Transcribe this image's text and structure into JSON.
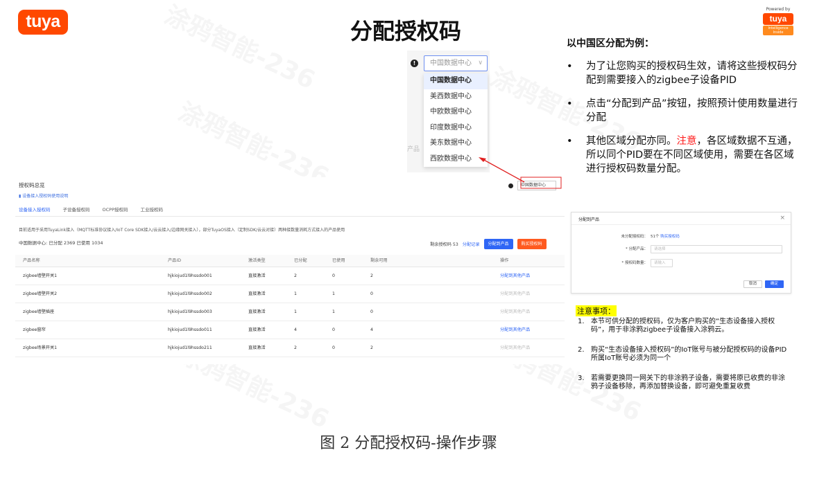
{
  "header": {
    "logo_text": "tuya",
    "title": "分配授权码",
    "powered_by": "Powered by",
    "powered_logo": "tuya",
    "powered_sub": "Intelligence Inside"
  },
  "dropdown": {
    "placeholder": "中国数据中心",
    "options": [
      "中国数据中心",
      "美西数据中心",
      "中欧数据中心",
      "印度数据中心",
      "美东数据中心",
      "西欧数据中心"
    ],
    "side_label": "产品"
  },
  "portal": {
    "title": "授权码总览",
    "help_link": "设备接入授权码使用说明",
    "tabs": [
      "设备接入授权码",
      "子设备授权码",
      "OCPP授权码",
      "工业授权码"
    ],
    "description": "目前适用于采用TuyaLink接入（MQTT标准协议接入/IoT Core SDK接入/云云接入/边缘网关接入），部分TuyaOS接入（定制SDK/云云对接）两种接数量消耗方式接入的产品使用",
    "stats": "中国数据中心: 已分配 2369    已使用 1034",
    "region_select": "中国数据中心",
    "remaining": "剩余授权码 53",
    "records_link": "分配记录",
    "assign_button": "分配到产品",
    "buy_button": "购买授权码",
    "columns": [
      "产品名称",
      "产品ID",
      "激活类型",
      "已分配",
      "已使用",
      "剩余可用",
      "操作"
    ],
    "rows": [
      {
        "name": "zigbee墙壁开关1",
        "pid": "hjkiojud1l9hssdo001",
        "type": "直接激活",
        "assigned": "2",
        "used": "0",
        "remain": "2",
        "action": "分配到其他产品"
      },
      {
        "name": "zigbee墙壁开关2",
        "pid": "hjkiojud1l9hssdo002",
        "type": "直接激活",
        "assigned": "1",
        "used": "1",
        "remain": "0",
        "action": "分配到其他产品"
      },
      {
        "name": "zigbee墙壁插座",
        "pid": "hjkiojud1l9hssdo003",
        "type": "直接激活",
        "assigned": "1",
        "used": "1",
        "remain": "0",
        "action": "分配到其他产品"
      },
      {
        "name": "zigbee窗帘",
        "pid": "hjkiojud1l9hssdo011",
        "type": "直接激活",
        "assigned": "4",
        "used": "0",
        "remain": "4",
        "action": "分配到其他产品"
      },
      {
        "name": "zigbee场景开关1",
        "pid": "hjkiojud1l9hssdo211",
        "type": "直接激活",
        "assigned": "2",
        "used": "0",
        "remain": "2",
        "action": "分配到其他产品"
      }
    ]
  },
  "notes": {
    "heading": "以中国区分配为例：",
    "bullet1": "为了让您购买的授权码生效，请将这些授权码分配到需要接入的zigbee子设备PID",
    "bullet2": "点击“分配到产品”按钮，按照预计使用数量进行分配",
    "bullet3_a": "其他区域分配亦同。",
    "bullet3_red": "注意",
    "bullet3_b": "，各区域数据不互通，所以同个PID要在不同区域使用，需要在各区域进行授权码数量分配。"
  },
  "dialog": {
    "title": "分配到产品",
    "close": "×",
    "unassigned_label": "未分配授权码：",
    "unassigned_value": "51个",
    "buy_link": "购买授权码",
    "product_label": "* 分配产品：",
    "product_placeholder": "请选择",
    "count_label": "* 授权码数量：",
    "count_placeholder": "请输入",
    "cancel": "取消",
    "confirm": "确定"
  },
  "attention": {
    "heading": "注意事项：",
    "items": [
      {
        "num": "1.",
        "text": "本节可供分配的授权码，仅为客户购买的“生态设备接入授权码”，用于非涂鸦zigbee子设备接入涂鸦云。"
      },
      {
        "num": "2.",
        "text": "购买“生态设备接入授权码”的IoT账号与被分配授权码的设备PID所属IoT账号必须为同一个"
      },
      {
        "num": "3.",
        "text": "若需要更换同一网关下的非涂鸦子设备，需要将原已收费的非涂鸦子设备移除，再添加替换设备，即可避免重复收费"
      }
    ]
  },
  "caption": "图 2   分配授权码-操作步骤",
  "colors": {
    "brand": "#ff4800",
    "link": "#2f66f5",
    "buy": "#ff5a1f",
    "note_red": "#ff1a1a",
    "highlight": "#ffff00"
  }
}
